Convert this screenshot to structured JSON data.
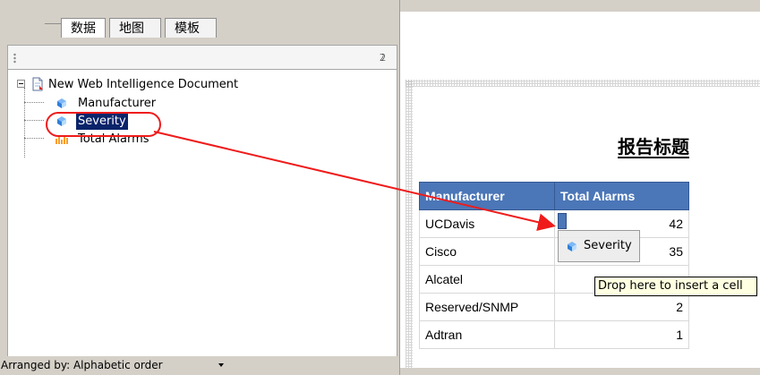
{
  "left_panel": {
    "tabs": [
      {
        "label": "数据",
        "active": true
      },
      {
        "label": "地图",
        "active": false
      },
      {
        "label": "模板",
        "active": false
      }
    ],
    "pin_icon": "pin-icon",
    "tree": {
      "root": "New Web Intelligence Document",
      "items": [
        {
          "label": "Manufacturer",
          "icon": "dimension-icon"
        },
        {
          "label": "Severity",
          "icon": "dimension-icon",
          "selected": true
        },
        {
          "label": "Total Alarms",
          "icon": "measure-icon"
        }
      ]
    },
    "bottom_bar": {
      "label": "Arranged by: Alphabetic order"
    }
  },
  "report": {
    "title": "报告标题",
    "table": {
      "columns": [
        "Manufacturer",
        "Total Alarms"
      ],
      "rows": [
        {
          "manufacturer": "UCDavis",
          "total_alarms": "42"
        },
        {
          "manufacturer": "Cisco",
          "total_alarms": "35"
        },
        {
          "manufacturer": "Alcatel",
          "total_alarms": ""
        },
        {
          "manufacturer": "Reserved/SNMP",
          "total_alarms": "2"
        },
        {
          "manufacturer": "Adtran",
          "total_alarms": "1"
        }
      ]
    },
    "drag_item": {
      "label": "Severity",
      "icon": "dimension-icon"
    },
    "tooltip": "Drop here to insert a cell"
  },
  "colors": {
    "selection_blue": "#0a246a",
    "table_header": "#4b76b7",
    "annotation_red": "#ef1b1b",
    "tooltip_bg": "#ffffe1"
  }
}
